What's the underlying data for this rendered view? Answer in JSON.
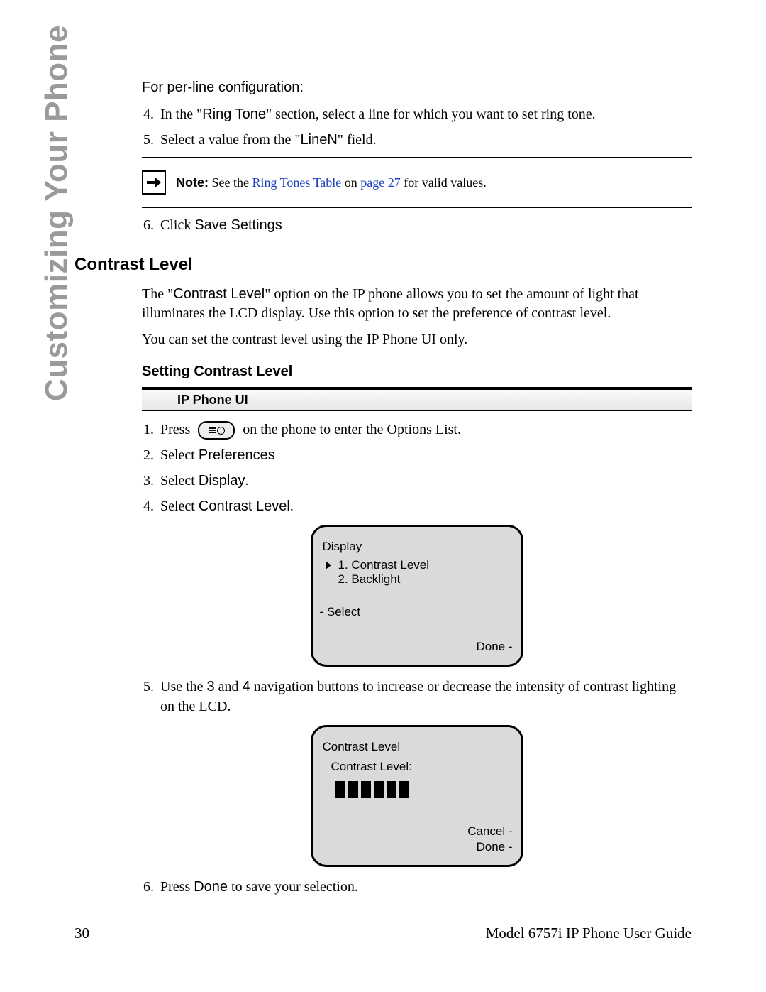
{
  "side_title": "Customizing Your Phone",
  "intro_line": "For per-line configuration:",
  "steps_a": {
    "start": 4,
    "s4_prefix": "In the \"",
    "s4_ui": "Ring Tone",
    "s4_suffix": "\" section, select a line for which you want to set ring tone.",
    "s5_prefix": "Select a value from the \"",
    "s5_ui": "LineN",
    "s5_suffix": "\" field."
  },
  "note": {
    "label": "Note:",
    "before_link": " See the ",
    "link1": "Ring Tones Table",
    "mid": " on ",
    "link2": "page 27",
    "after": " for valid values."
  },
  "step6a_prefix": "Click ",
  "step6a_ui": "Save Settings",
  "section_heading": "Contrast Level",
  "para1_prefix": "The \"",
  "para1_ui": "Contrast Level",
  "para1_suffix": "\" option on the IP phone allows you to set the amount of light that illuminates the LCD display. Use this option to set the preference of contrast level.",
  "para2": "You can set the contrast level using the IP Phone UI only.",
  "subsection_heading": "Setting Contrast Level",
  "ui_bar": "IP Phone UI",
  "steps_b": {
    "s1_prefix": "Press ",
    "s1_suffix": " on the phone to enter the Options List.",
    "s2_prefix": "Select ",
    "s2_ui": "Preferences",
    "s3_prefix": "Select ",
    "s3_ui": "Display",
    "s3_suffix": ".",
    "s4_prefix": "Select ",
    "s4_ui": "Contrast Level",
    "s4_suffix": ".",
    "s5_a": "Use the ",
    "s5_key1": "3",
    "s5_b": " and ",
    "s5_key2": "4",
    "s5_c": " navigation buttons to increase or decrease the intensity of contrast lighting on the LCD.",
    "s6_prefix": "Press ",
    "s6_ui": "Done",
    "s6_suffix": " to save your selection."
  },
  "lcd1": {
    "title": "Display",
    "item1": "1. Contrast Level",
    "item2": "2. Backlight",
    "select": "- Select",
    "done": "Done -"
  },
  "lcd2": {
    "title": "Contrast Level",
    "label": "Contrast Level:",
    "cancel": "Cancel -",
    "done": "Done -"
  },
  "footer": {
    "page": "30",
    "guide": "Model 6757i IP Phone User Guide"
  }
}
